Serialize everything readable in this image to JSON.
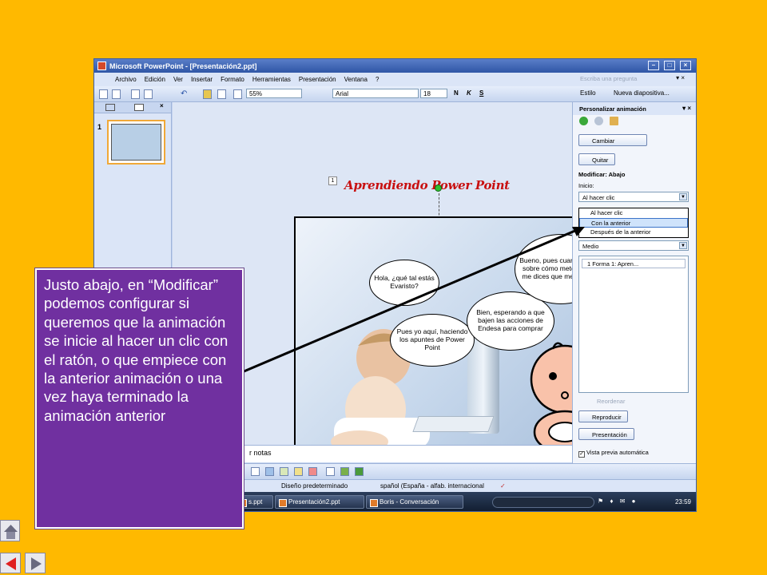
{
  "window": {
    "title": "Microsoft PowerPoint - [Presentación2.ppt]"
  },
  "menu": {
    "items": [
      "Archivo",
      "Edición",
      "Ver",
      "Insertar",
      "Formato",
      "Herramientas",
      "Presentación",
      "Ventana",
      "?"
    ],
    "ask_placeholder": "Escriba una pregunta"
  },
  "toolbar": {
    "zoom": "55%",
    "font": "Arial",
    "size": "18",
    "bold": "N",
    "italic": "K",
    "underline": "S",
    "style_label": "Estilo",
    "new_slide_label": "Nueva diapositiva..."
  },
  "thumbnails": {
    "slide_number": "1"
  },
  "slide": {
    "placeholder_number": "1",
    "title": "Aprendiendo Power Point",
    "bubbles": [
      "Hola, ¿qué tal estás Evaristo?",
      "Pues yo aquí, haciendo los apuntes de Power Point",
      "Bien, esperando a que bajen las acciones de Endesa para comprar",
      "Bueno, pues cuando hagas sobre cómo meter sonido me dices que me interesa"
    ]
  },
  "notes": {
    "text": "r notas"
  },
  "statusbar": {
    "design": "Diseño predeterminado",
    "language": "spañol (España - alfab. internacional"
  },
  "taskbar": {
    "items": [
      "s.ppt",
      "Presentación2.ppt",
      "Boris - Conversación"
    ],
    "clock": "23:59"
  },
  "taskpane": {
    "title": "Personalizar animación",
    "change_button": "Cambiar",
    "remove_button": "Quitar",
    "modify_label": "Modificar: Abajo",
    "start_label": "Inicio:",
    "start_value": "Al hacer clic",
    "start_options": [
      "Al hacer clic",
      "Con la anterior",
      "Después de la anterior"
    ],
    "speed_value": "Medio",
    "animation_item": "1     Forma 1: Apren...",
    "reorder_label": "Reordenar",
    "play_button": "Reproducir",
    "slideshow_button": "Presentación",
    "autopreview_label": "Vista previa automática"
  },
  "callout": {
    "text": "Justo abajo, en “Modificar” podemos configurar si queremos que la animación se inicie al hacer un clic con el ratón, o que empiece con la anterior animación o una vez haya terminado la animación anterior"
  },
  "colors": {
    "background": "#FFB900",
    "callout": "#7030A0",
    "title_red": "#C81010"
  },
  "icons": [
    "home-icon",
    "prev-slide-icon",
    "next-slide-icon"
  ]
}
